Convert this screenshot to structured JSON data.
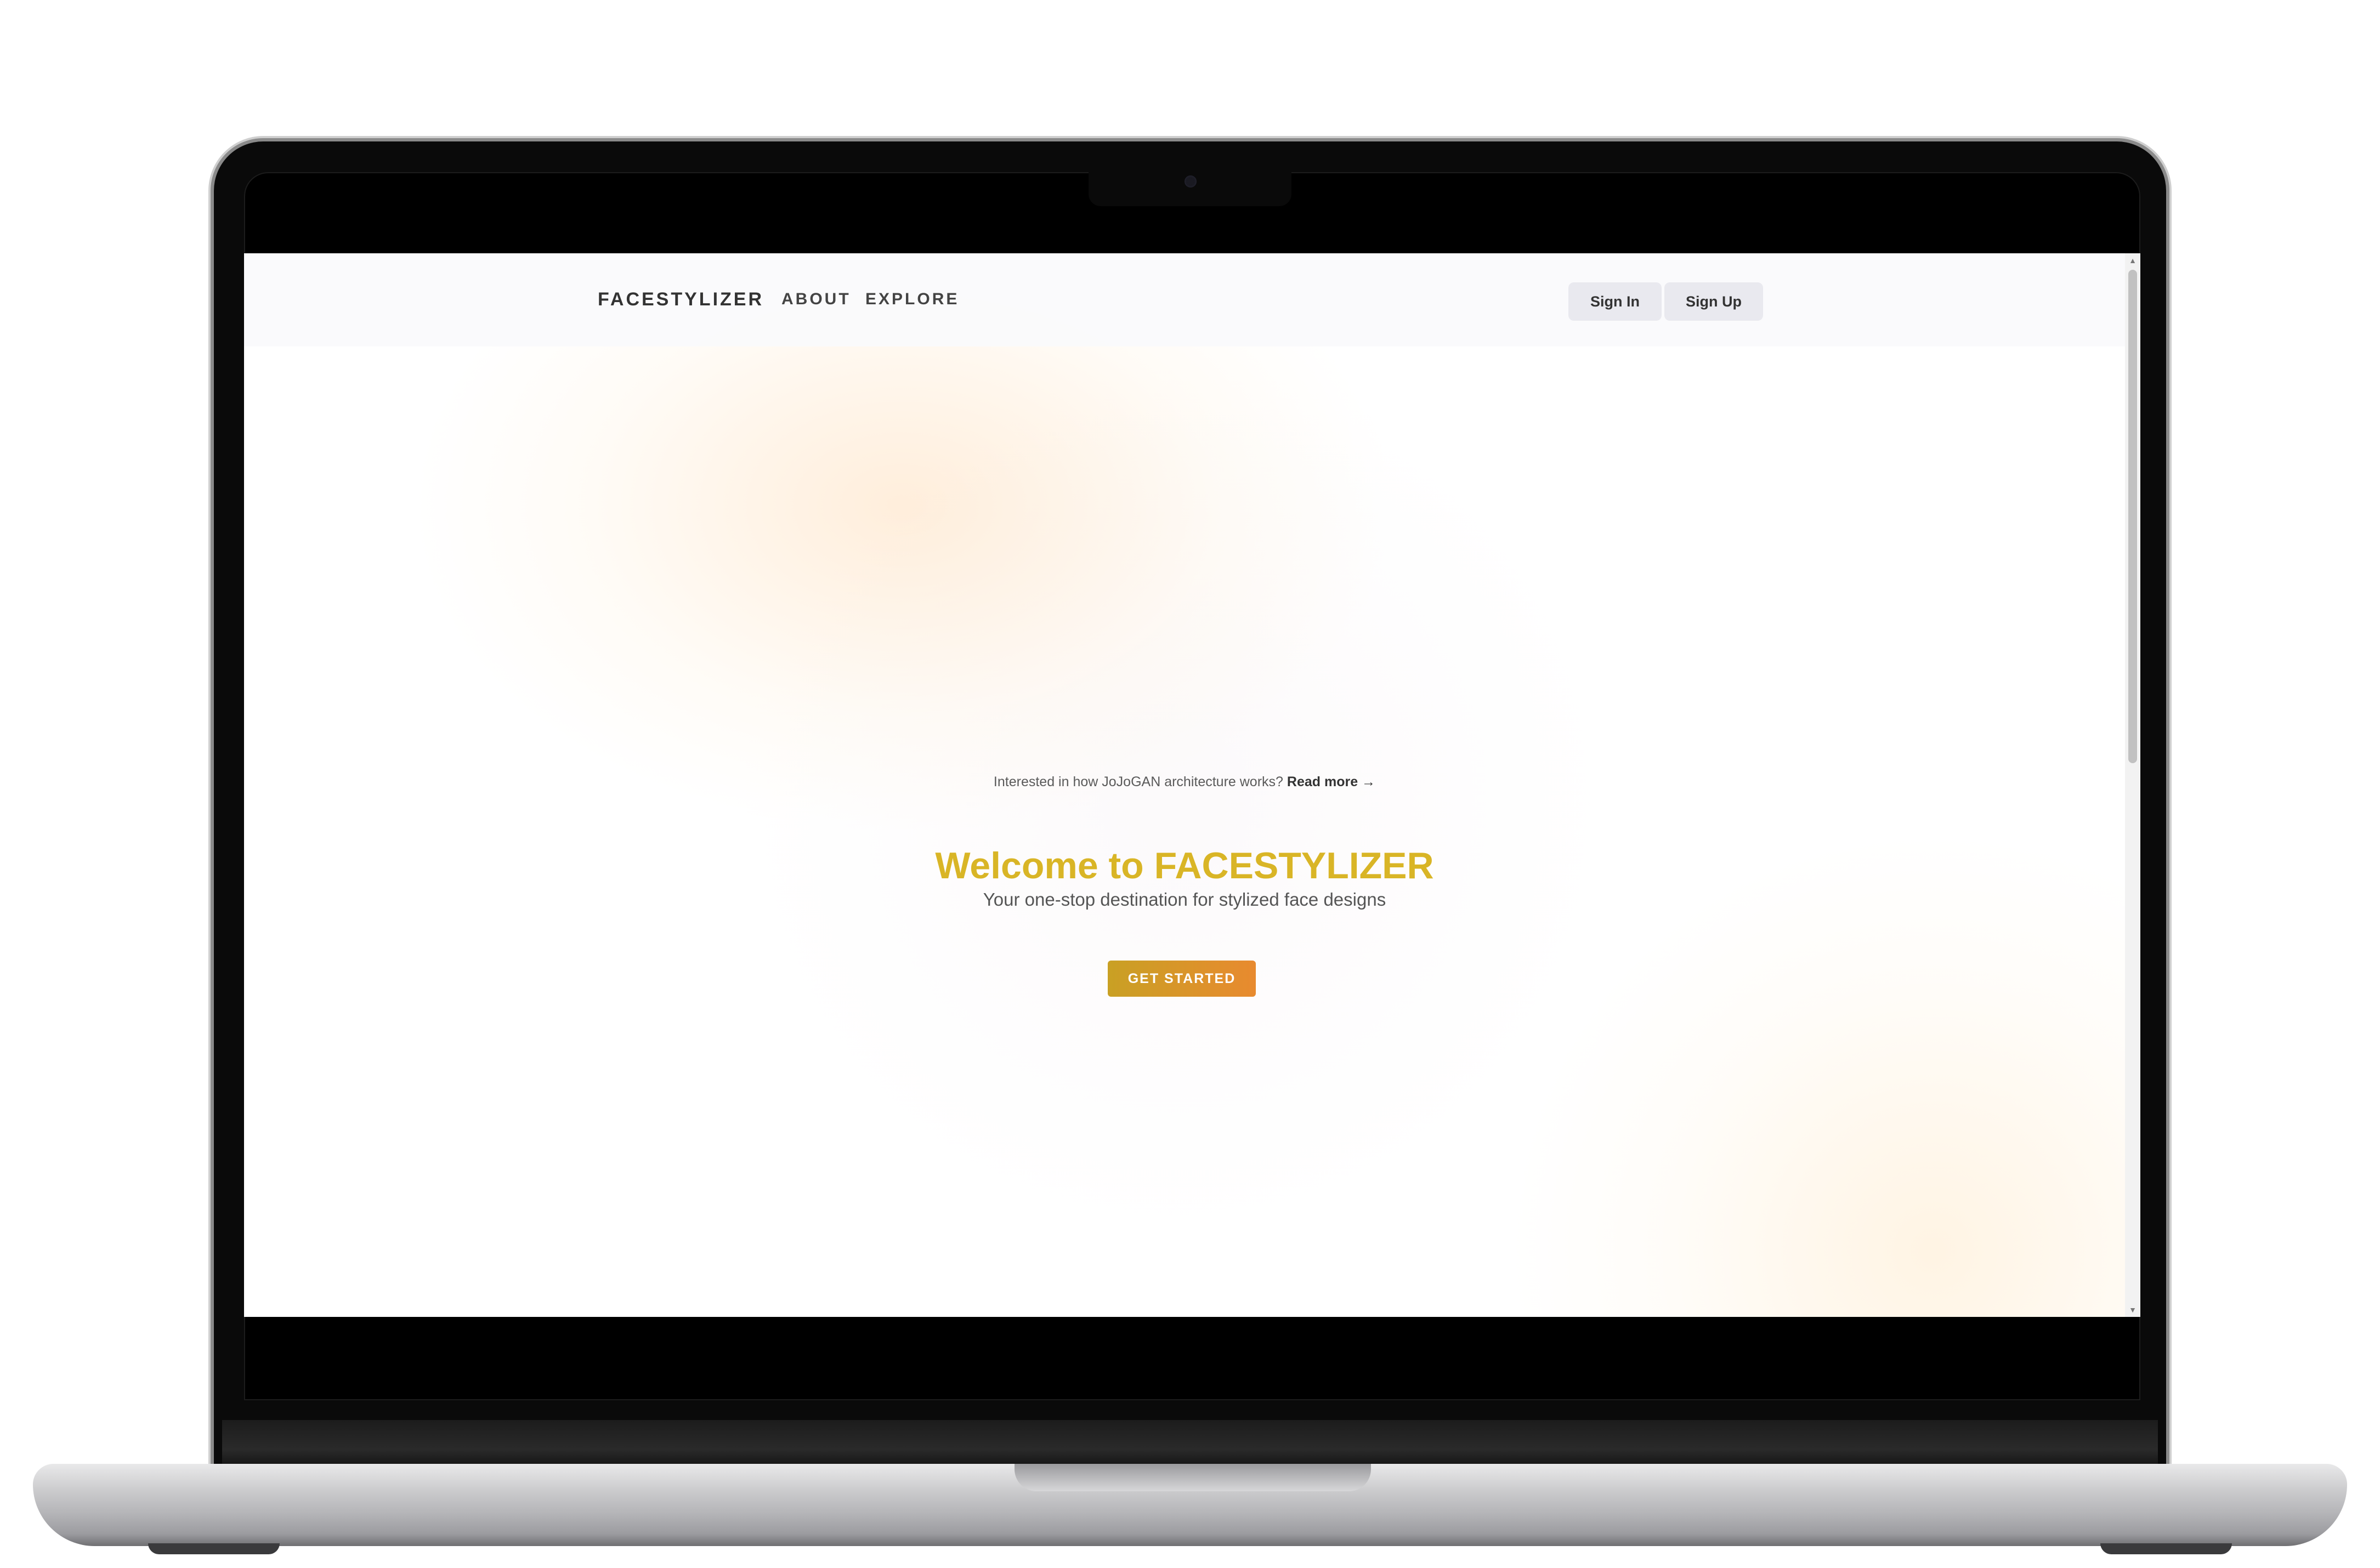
{
  "navbar": {
    "brand": "FACESTYLIZER",
    "links": [
      {
        "label": "ABOUT"
      },
      {
        "label": "EXPLORE"
      }
    ],
    "sign_in_label": "Sign In",
    "sign_up_label": "Sign Up"
  },
  "hero": {
    "note_text": "Interested in how JoJoGAN architecture works?",
    "note_link": "Read more →",
    "title": "Welcome to FACESTYLIZER",
    "subtitle": "Your one-stop destination for stylized face designs",
    "cta_label": "GET STARTED"
  },
  "icons": {
    "scroll_up": "▲",
    "scroll_down": "▼"
  },
  "colors": {
    "title": "#d9b526",
    "cta_start": "#c9a024",
    "cta_end": "#e88a2f"
  }
}
